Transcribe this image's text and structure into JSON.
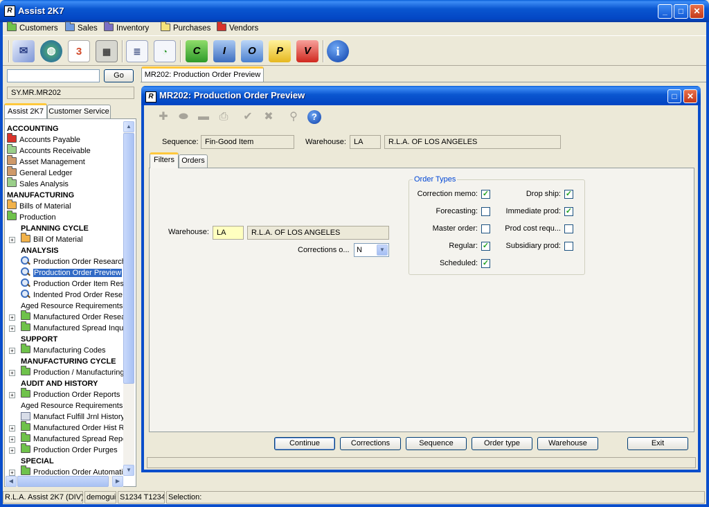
{
  "app": {
    "title": "Assist 2K7",
    "icon": "rla-logo-icon"
  },
  "menu": [
    "Customers",
    "Sales",
    "Inventory",
    "Purchases",
    "Vendors"
  ],
  "toolbar_icons": [
    "mail-icon",
    "globe-icon",
    "calendar-icon",
    "calculator-icon",
    "report-icon",
    "chart-report-icon",
    "c-folder-icon",
    "i-folder-icon",
    "o-folder-icon",
    "p-folder-icon",
    "v-folder-icon",
    "info-icon"
  ],
  "toolbar_letters": {
    "c": "C",
    "i": "I",
    "o": "O",
    "p": "P",
    "v": "V",
    "info": "i"
  },
  "left": {
    "search_value": "",
    "go_label": "Go",
    "path": "SY.MR.MR202",
    "tabs": [
      "Assist 2K7",
      "Customer Service"
    ],
    "tree": [
      "ACCOUNTING",
      "Accounts Payable",
      "Accounts Receivable",
      "Asset Management",
      "General Ledger",
      "Sales Analysis",
      "MANUFACTURING",
      "Bills of Material",
      "Production",
      "PLANNING CYCLE",
      "Bill Of Material",
      "ANALYSIS",
      "Production Order Research",
      "Production Order Preview",
      "Production Order Item Res",
      "Indented Prod Order Rese",
      "Aged Resource Requirements",
      "Manufactured Order Resea",
      "Manufactured Spread Inqu",
      "SUPPORT",
      "Manufacturing Codes",
      "MANUFACTURING CYCLE",
      "Production / Manufacturing",
      "AUDIT AND HISTORY",
      "Production Order Reports",
      "Aged Resource Requirements F",
      "Manufact Fulfill Jrnl History",
      "Manufactured Order Hist R",
      "Manufactured Spread Repo",
      "Production Order Purges",
      "SPECIAL",
      "Production Order Automati"
    ]
  },
  "doc_tab": "MR202: Production Order Preview",
  "window": {
    "title": "MR202: Production Order Preview",
    "sequence_label": "Sequence:",
    "sequence_value": "Fin-Good Item",
    "warehouse_label": "Warehouse:",
    "warehouse_code": "LA",
    "warehouse_name": "R.L.A. OF LOS ANGELES",
    "tabs": [
      "Filters",
      "Orders"
    ],
    "filters": {
      "warehouse_label": "Warehouse:",
      "warehouse_code": "LA",
      "warehouse_name": "R.L.A. OF LOS ANGELES",
      "corrections_label": "Corrections o...",
      "corrections_value": "N"
    },
    "order_types": {
      "legend": "Order Types",
      "items": [
        {
          "label": "Correction memo:",
          "checked": true
        },
        {
          "label": "Forecasting:",
          "checked": false
        },
        {
          "label": "Master order:",
          "checked": false
        },
        {
          "label": "Regular:",
          "checked": true
        },
        {
          "label": "Scheduled:",
          "checked": true
        },
        {
          "label": "Drop ship:",
          "checked": true
        },
        {
          "label": "Immediate prod:",
          "checked": true
        },
        {
          "label": "Prod cost requ...",
          "checked": false
        },
        {
          "label": "Subsidiary prod:",
          "checked": false
        }
      ]
    },
    "buttons": [
      "Continue",
      "Corrections",
      "Sequence",
      "Order type",
      "Warehouse",
      "Exit"
    ]
  },
  "status": [
    "R.L.A. Assist 2K7 (DIV)",
    "demogui",
    "S1234 T1234",
    "Selection:"
  ],
  "colors": {
    "titlebar": "#0a56d0",
    "selection": "#316ac5",
    "yellow_field": "#ffffc0",
    "legend": "#0046d5"
  }
}
